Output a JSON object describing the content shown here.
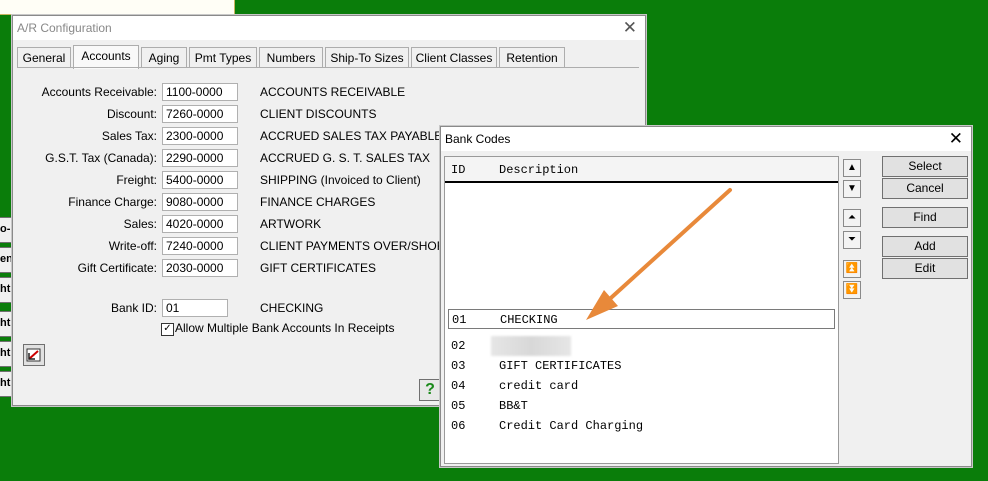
{
  "background": {
    "color": "#0a7d0a",
    "side_fragments": [
      "o-l",
      "en",
      "ht",
      "ht",
      "ht",
      "ht"
    ]
  },
  "ar_window": {
    "title": "A/R Configuration",
    "tabs": [
      "General",
      "Accounts",
      "Aging",
      "Pmt Types",
      "Numbers",
      "Ship-To Sizes",
      "Client Classes",
      "Retention"
    ],
    "active_tab": "Accounts",
    "accounts": [
      {
        "label": "Accounts Receivable:",
        "code": "1100-0000",
        "description": "ACCOUNTS RECEIVABLE"
      },
      {
        "label": "Discount:",
        "code": "7260-0000",
        "description": "CLIENT DISCOUNTS"
      },
      {
        "label": "Sales Tax:",
        "code": "2300-0000",
        "description": "ACCRUED SALES TAX PAYABLE"
      },
      {
        "label": "G.S.T. Tax (Canada):",
        "code": "2290-0000",
        "description": "ACCRUED G. S. T. SALES TAX"
      },
      {
        "label": "Freight:",
        "code": "5400-0000",
        "description": "SHIPPING (Invoiced to Client)"
      },
      {
        "label": "Finance Charge:",
        "code": "9080-0000",
        "description": "FINANCE CHARGES"
      },
      {
        "label": "Sales:",
        "code": "4020-0000",
        "description": "ARTWORK"
      },
      {
        "label": "Write-off:",
        "code": "7240-0000",
        "description": "CLIENT PAYMENTS OVER/SHORT"
      },
      {
        "label": "Gift Certificate:",
        "code": "2030-0000",
        "description": "GIFT CERTIFICATES"
      }
    ],
    "bank": {
      "label": "Bank ID:",
      "value": "01",
      "description": "CHECKING"
    },
    "allow_multiple": {
      "label": "Allow Multiple Bank Accounts In Receipts",
      "checked": true
    }
  },
  "bank_window": {
    "title": "Bank Codes",
    "columns": {
      "id": "ID",
      "description": "Description"
    },
    "search_row": {
      "id": "01",
      "description": "CHECKING"
    },
    "rows": [
      {
        "id": "02",
        "description": ""
      },
      {
        "id": "03",
        "description": "GIFT CERTIFICATES"
      },
      {
        "id": "04",
        "description": "credit card"
      },
      {
        "id": "05",
        "description": "BB&T"
      },
      {
        "id": "06",
        "description": "Credit Card Charging"
      }
    ],
    "buttons": {
      "select": "Select",
      "cancel": "Cancel",
      "find": "Find",
      "add": "Add",
      "edit": "Edit"
    }
  },
  "annotation": {
    "arrow_color": "#e8893a"
  }
}
